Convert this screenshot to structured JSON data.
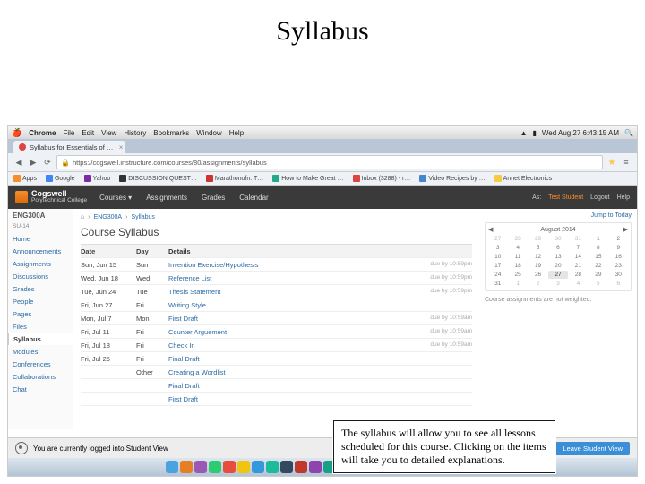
{
  "slide_title": "Syllabus",
  "mac_menu": {
    "app": "Chrome",
    "items": [
      "File",
      "Edit",
      "View",
      "History",
      "Bookmarks",
      "Window",
      "Help"
    ],
    "clock": "Wed Aug 27  6:43:15 AM"
  },
  "browser": {
    "tab_title": "Syllabus for Essentials of …",
    "url": "https://cogswell.instructure.com/courses/80/assignments/syllabus",
    "bookmarks": [
      "Apps",
      "Google",
      "Yahoo",
      "DISCUSSION QUEST…",
      "Marathonofn. T…",
      "How to Make Great …",
      "Inbox (3288) - r…",
      "Video Recipes by …",
      "Annet Electronics"
    ]
  },
  "canvas": {
    "logo_top": "Cogswell",
    "logo_bottom": "Polytechnical College",
    "topnav": [
      "Courses ▾",
      "Assignments",
      "Grades",
      "Calendar"
    ],
    "topright_prefix": "As:",
    "topright_user": "Test Student",
    "topright_links": [
      "Logout",
      "Help"
    ]
  },
  "sidebar": {
    "course": "ENG300A",
    "term": "SU-14",
    "items": [
      "Home",
      "Announcements",
      "Assignments",
      "Discussions",
      "Grades",
      "People",
      "Pages",
      "Files",
      "Syllabus",
      "Modules",
      "Conferences",
      "Collaborations",
      "Chat"
    ]
  },
  "breadcrumb": [
    "ENG300A",
    "Syllabus"
  ],
  "main_title": "Course Syllabus",
  "table": {
    "headers": {
      "date": "Date",
      "day": "Day",
      "details": "Details"
    },
    "rows": [
      {
        "date": "Sun, Jun 15",
        "day": "Sun",
        "details": "Invention Exercise/Hypothesis",
        "due": "due by 10:59pm"
      },
      {
        "date": "Wed, Jun 18",
        "day": "Wed",
        "details": "Reference List",
        "due": "due by 10:59pm"
      },
      {
        "date": "Tue, Jun 24",
        "day": "Tue",
        "details": "Thesis Statement",
        "due": "due by 10:59pm"
      },
      {
        "date": "Fri, Jun 27",
        "day": "Fri",
        "details": "Writing Style",
        "due": ""
      },
      {
        "date": "Mon, Jul 7",
        "day": "Mon",
        "details": "First Draft",
        "due": "due by 10:59am"
      },
      {
        "date": "Fri, Jul 11",
        "day": "Fri",
        "details": "Counter Arguement",
        "due": "due by 10:59am"
      },
      {
        "date": "Fri, Jul 18",
        "day": "Fri",
        "details": "Check In",
        "due": "due by 10:59am"
      },
      {
        "date": "Fri, Jul 25",
        "day": "Fri",
        "details": "Final Draft",
        "due": ""
      },
      {
        "date": "",
        "day": "Other",
        "details": "Creating a Wordlist",
        "due": ""
      },
      {
        "date": "",
        "day": "",
        "details": "Final Draft",
        "due": ""
      },
      {
        "date": "",
        "day": "",
        "details": "First Draft",
        "due": ""
      }
    ]
  },
  "rightbar": {
    "jump": "Jump to Today",
    "month": "August 2014",
    "weights_note": "Course assignments are not weighted."
  },
  "studentview": {
    "text": "You are currently logged into Student View",
    "leave": "Leave Student View"
  },
  "callout": "The syllabus will allow you to see all lessons scheduled for this course. Clicking on the items will take you to detailed explanations."
}
